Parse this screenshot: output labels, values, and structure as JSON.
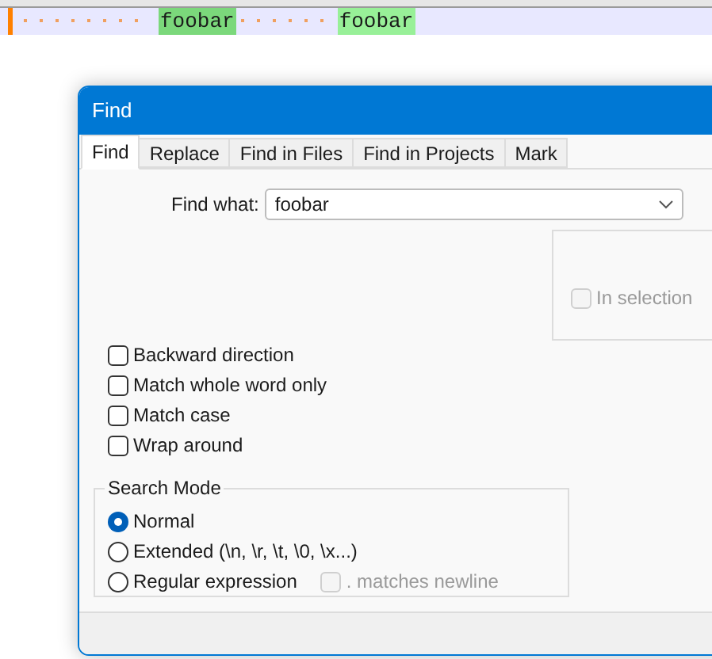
{
  "editor": {
    "matches": [
      {
        "text": "foobar",
        "current": true
      },
      {
        "text": "foobar",
        "current": false
      }
    ]
  },
  "dialog": {
    "title": "Find",
    "tabs": [
      {
        "label": "Find",
        "selected": true
      },
      {
        "label": "Replace",
        "selected": false
      },
      {
        "label": "Find in Files",
        "selected": false
      },
      {
        "label": "Find in Projects",
        "selected": false
      },
      {
        "label": "Mark",
        "selected": false
      }
    ],
    "find_what": {
      "label": "Find what:",
      "value": "foobar"
    },
    "in_selection": {
      "label": "In selection",
      "checked": false,
      "disabled": true
    },
    "options": [
      {
        "label": "Backward direction",
        "checked": false
      },
      {
        "label": "Match whole word only",
        "checked": false
      },
      {
        "label": "Match case",
        "checked": false
      },
      {
        "label": "Wrap around",
        "checked": false
      }
    ],
    "search_mode": {
      "title": "Search Mode",
      "modes": [
        {
          "label": "Normal",
          "selected": true
        },
        {
          "label": "Extended (\\n, \\r, \\t, \\0, \\x...)",
          "selected": false
        },
        {
          "label": "Regular expression",
          "selected": false
        }
      ],
      "dot_matches_newline": {
        "label": ". matches newline",
        "checked": false,
        "disabled": true
      }
    }
  }
}
